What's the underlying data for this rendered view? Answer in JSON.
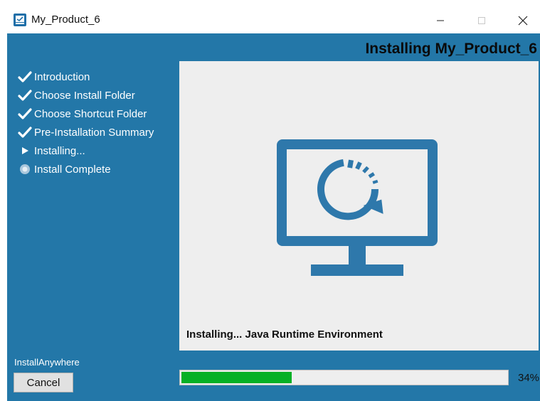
{
  "window": {
    "title": "My_Product_6",
    "app_icon": "installer-app-icon",
    "controls": {
      "minimize": "minimize-icon",
      "maximize": "maximize-icon",
      "close": "close-icon"
    }
  },
  "header": {
    "title": "Installing My_Product_6"
  },
  "steps": [
    {
      "label": "Introduction",
      "status": "done",
      "icon": "checkmark-icon"
    },
    {
      "label": "Choose Install Folder",
      "status": "done",
      "icon": "checkmark-icon"
    },
    {
      "label": "Choose Shortcut Folder",
      "status": "done",
      "icon": "checkmark-icon"
    },
    {
      "label": "Pre-Installation Summary",
      "status": "done",
      "icon": "checkmark-icon"
    },
    {
      "label": "Installing...",
      "status": "current",
      "icon": "arrow-right-icon"
    },
    {
      "label": "Install Complete",
      "status": "pending",
      "icon": "pending-dot-icon"
    }
  ],
  "content": {
    "illustration": "monitor-loading-icon",
    "status": "Installing... Java Runtime Environment"
  },
  "footer": {
    "brand": "InstallAnywhere",
    "cancel_label": "Cancel",
    "progress_percent": 34,
    "progress_label": "34%"
  },
  "colors": {
    "background": "#2377a8",
    "panel": "#eeeeee",
    "illustration": "#2e78ab",
    "progress": "#06b025"
  }
}
